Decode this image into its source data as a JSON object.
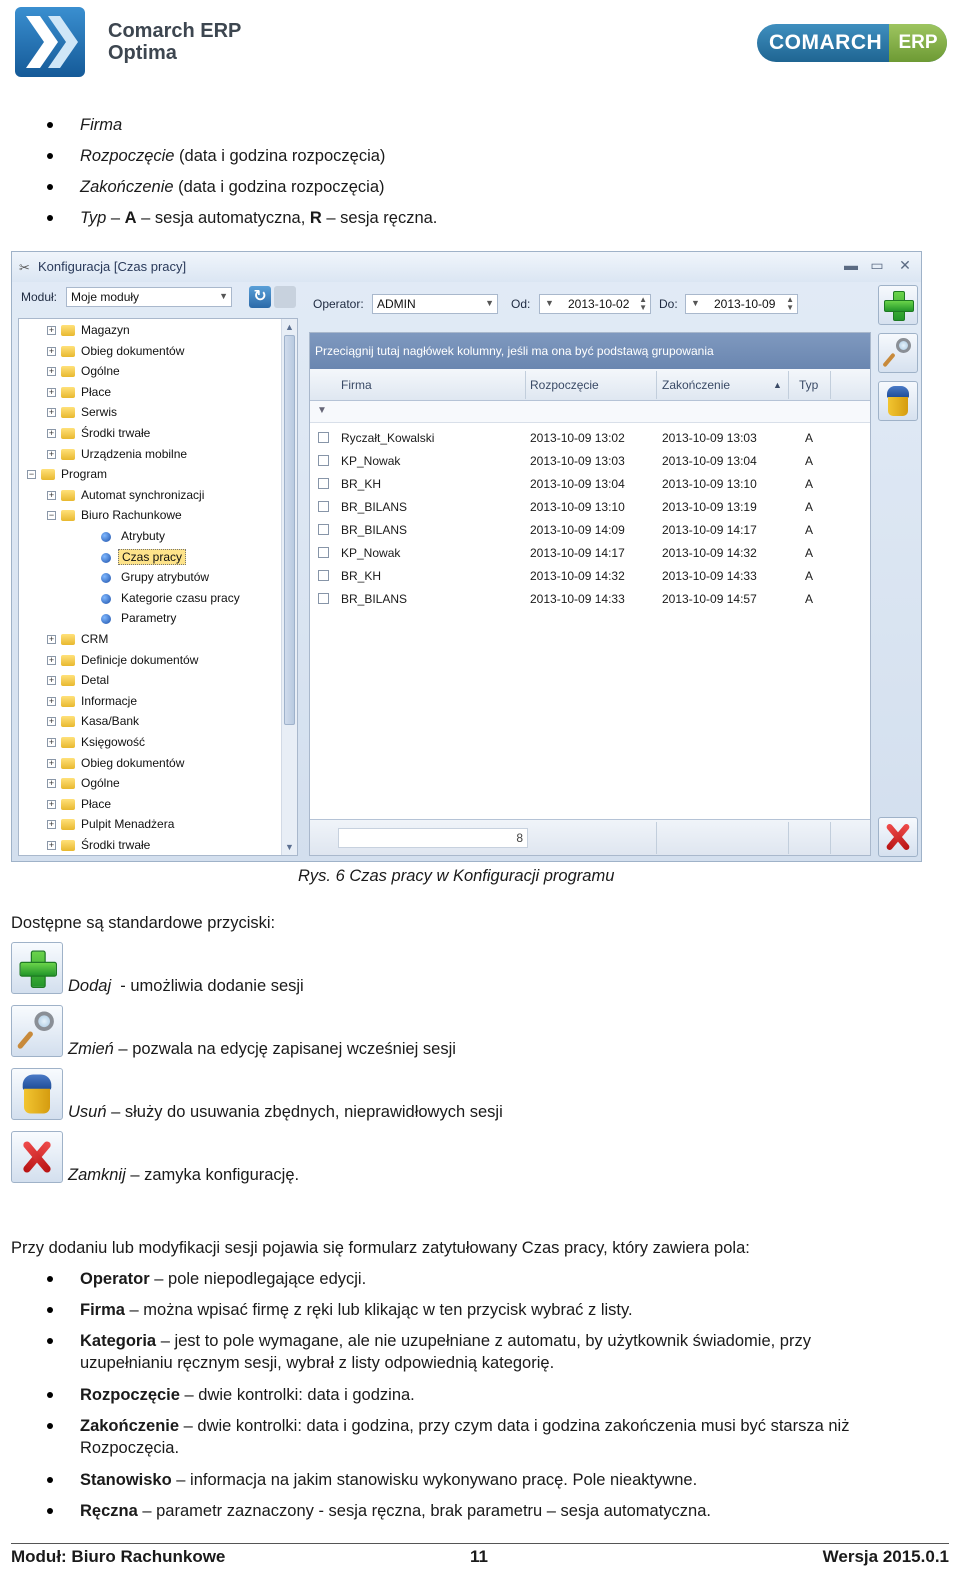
{
  "header": {
    "brand_line1": "Comarch ERP",
    "brand_line2": "Optima",
    "comarch_logo_text": "COMARCH",
    "erp_badge": "ERP"
  },
  "top_bullets": [
    {
      "term": "Firma",
      "rest": ""
    },
    {
      "term": "Rozpoczęcie",
      "rest": " (data i godzina rozpoczęcia)"
    },
    {
      "term": "Zakończenie",
      "rest": " (data i godzina rozpoczęcia)"
    },
    {
      "term": "Typ",
      "rest_1": " – ",
      "bold_1": "A",
      "rest_2": " – sesja automatyczna, ",
      "bold_2": "R",
      "rest_3": " – sesja ręczna."
    }
  ],
  "window": {
    "title": "Konfiguracja [Czas pracy]",
    "modul_label": "Moduł:",
    "modul_value": "Moje moduły",
    "operator_label": "Operator:",
    "operator_value": "ADMIN",
    "od_label": "Od:",
    "od_value": "2013-10-02",
    "do_label": "Do:",
    "do_value": "2013-10-09",
    "group_hint": "Przeciągnij tutaj nagłówek kolumny, jeśli ma ona być podstawą grupowania",
    "columns": [
      "Firma",
      "Rozpoczęcie",
      "Zakończenie",
      "Typ"
    ],
    "sort_indicator": "▲",
    "rows": [
      [
        "Ryczałt_Kowalski",
        "2013-10-09 13:02",
        "2013-10-09 13:03",
        "A"
      ],
      [
        "KP_Nowak",
        "2013-10-09 13:03",
        "2013-10-09 13:04",
        "A"
      ],
      [
        "BR_KH",
        "2013-10-09 13:04",
        "2013-10-09 13:10",
        "A"
      ],
      [
        "BR_BILANS",
        "2013-10-09 13:10",
        "2013-10-09 13:19",
        "A"
      ],
      [
        "BR_BILANS",
        "2013-10-09 14:09",
        "2013-10-09 14:17",
        "A"
      ],
      [
        "KP_Nowak",
        "2013-10-09 14:17",
        "2013-10-09 14:32",
        "A"
      ],
      [
        "BR_KH",
        "2013-10-09 14:32",
        "2013-10-09 14:33",
        "A"
      ],
      [
        "BR_BILANS",
        "2013-10-09 14:33",
        "2013-10-09 14:57",
        "A"
      ]
    ],
    "row_count": "8",
    "tree": [
      {
        "label": "Magazyn",
        "level": 0,
        "kind": "folder",
        "exp": "+"
      },
      {
        "label": "Obieg dokumentów",
        "level": 0,
        "kind": "folder",
        "exp": "+"
      },
      {
        "label": "Ogólne",
        "level": 0,
        "kind": "folder",
        "exp": "+"
      },
      {
        "label": "Płace",
        "level": 0,
        "kind": "folder",
        "exp": "+"
      },
      {
        "label": "Serwis",
        "level": 0,
        "kind": "folder",
        "exp": "+"
      },
      {
        "label": "Środki trwałe",
        "level": 0,
        "kind": "folder",
        "exp": "+"
      },
      {
        "label": "Urządzenia mobilne",
        "level": 0,
        "kind": "folder",
        "exp": "+"
      },
      {
        "label": "Program",
        "level": -1,
        "kind": "folder",
        "exp": "−"
      },
      {
        "label": "Automat synchronizacji",
        "level": 0,
        "kind": "folder",
        "exp": "+"
      },
      {
        "label": "Biuro Rachunkowe",
        "level": 0,
        "kind": "folder",
        "exp": "−"
      },
      {
        "label": "Atrybuty",
        "level": 1,
        "kind": "item",
        "exp": ""
      },
      {
        "label": "Czas pracy",
        "level": 1,
        "kind": "item",
        "exp": "",
        "selected": true
      },
      {
        "label": "Grupy atrybutów",
        "level": 1,
        "kind": "item",
        "exp": ""
      },
      {
        "label": "Kategorie czasu pracy",
        "level": 1,
        "kind": "item",
        "exp": ""
      },
      {
        "label": "Parametry",
        "level": 1,
        "kind": "item",
        "exp": ""
      },
      {
        "label": "CRM",
        "level": 0,
        "kind": "folder",
        "exp": "+"
      },
      {
        "label": "Definicje dokumentów",
        "level": 0,
        "kind": "folder",
        "exp": "+"
      },
      {
        "label": "Detal",
        "level": 0,
        "kind": "folder",
        "exp": "+"
      },
      {
        "label": "Informacje",
        "level": 0,
        "kind": "folder",
        "exp": "+"
      },
      {
        "label": "Kasa/Bank",
        "level": 0,
        "kind": "folder",
        "exp": "+"
      },
      {
        "label": "Księgowość",
        "level": 0,
        "kind": "folder",
        "exp": "+"
      },
      {
        "label": "Obieg dokumentów",
        "level": 0,
        "kind": "folder",
        "exp": "+"
      },
      {
        "label": "Ogólne",
        "level": 0,
        "kind": "folder",
        "exp": "+"
      },
      {
        "label": "Płace",
        "level": 0,
        "kind": "folder",
        "exp": "+"
      },
      {
        "label": "Pulpit Menadżera",
        "level": 0,
        "kind": "folder",
        "exp": "+"
      },
      {
        "label": "Środki trwałe",
        "level": 0,
        "kind": "folder",
        "exp": "+"
      }
    ]
  },
  "caption": "Rys. 6 Czas pracy w Konfiguracji programu",
  "buttons_intro": "Dostępne są standardowe przyciski:",
  "buttons": [
    {
      "icon": "add-plus-icon",
      "name": "Dodaj",
      "desc": "  - umożliwia dodanie sesji"
    },
    {
      "icon": "edit-magnifier-icon",
      "name": "Zmień",
      "desc": " – pozwala na edycję zapisanej wcześniej sesji"
    },
    {
      "icon": "delete-bin-icon",
      "name": "Usuń",
      "desc": " – służy do usuwania zbędnych, nieprawidłowych sesji"
    },
    {
      "icon": "close-x-icon",
      "name": "Zamknij",
      "desc": " – zamyka konfigurację."
    }
  ],
  "form_intro": "Przy dodaniu lub modyfikacji sesji pojawia się formularz zatytułowany Czas pracy, który zawiera pola:",
  "form_fields": [
    {
      "term": "Operator",
      "desc": " – pole niepodlegające edycji."
    },
    {
      "term": "Firma",
      "desc": " – można wpisać firmę z ręki lub klikając w ten przycisk wybrać z listy."
    },
    {
      "term": "Kategoria",
      "desc": " – jest to pole wymagane, ale nie uzupełniane z automatu, by użytkownik świadomie, przy",
      "desc2": "uzupełnianiu ręcznym sesji, wybrał z listy odpowiednią kategorię."
    },
    {
      "term": "Rozpoczęcie",
      "desc": " – dwie kontrolki: data i godzina."
    },
    {
      "term": "Zakończenie",
      "desc": " – dwie kontrolki: data i godzina, przy czym data i godzina zakończenia musi być starsza niż",
      "desc2": "Rozpoczęcia."
    },
    {
      "term": "Stanowisko",
      "desc": " – informacja na jakim stanowisku wykonywano pracę. Pole nieaktywne."
    },
    {
      "term": "Ręczna",
      "desc": " – parametr zaznaczony - sesja ręczna, brak parametru – sesja automatyczna."
    }
  ],
  "footer": {
    "left": "Moduł: Biuro Rachunkowe",
    "center": "11",
    "right": "Wersja 2015.0.1"
  },
  "colors": {
    "window_bg": "#d8e3f0",
    "group_hint_bg": "#7590b8",
    "selected_tree_item": "#fde38a",
    "brand_blue": "#2c74a8",
    "brand_green": "#86b04a"
  }
}
